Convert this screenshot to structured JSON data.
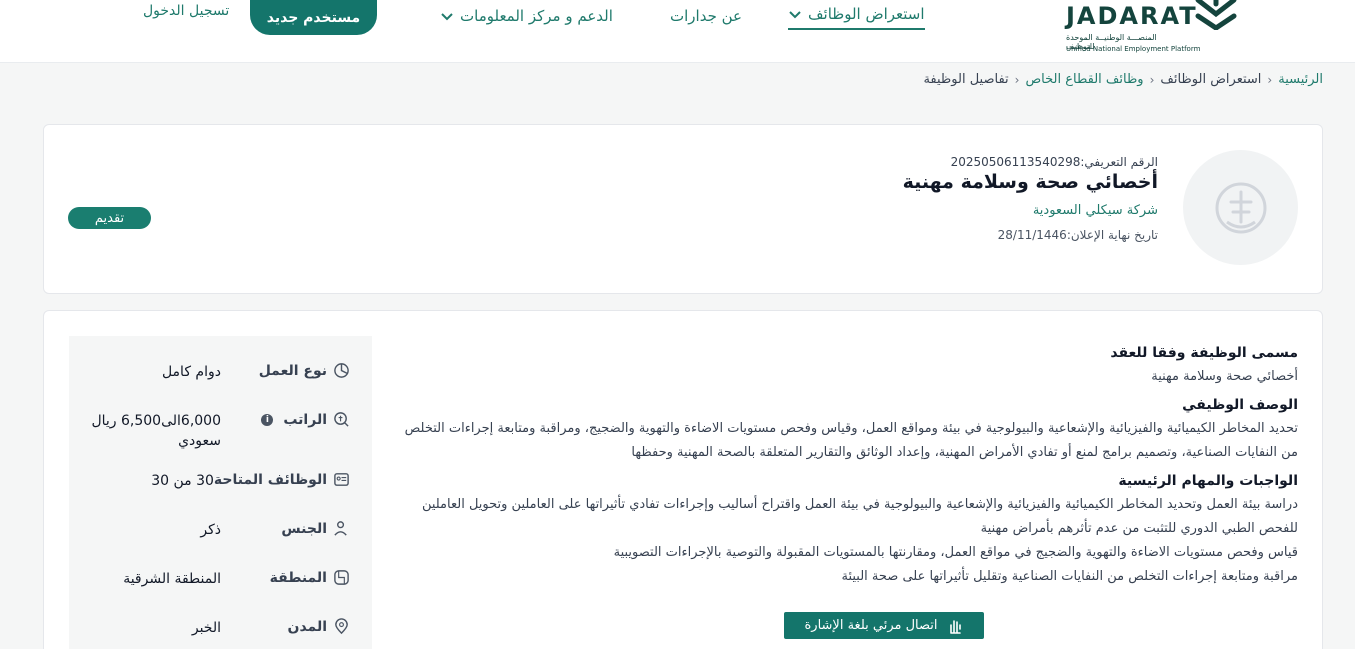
{
  "header": {
    "logo_word": "JADARAT",
    "logo_ar": "المنصـــة الوطنيــة الموحدة للتوظيف",
    "logo_en": "Unified National Employment Platform",
    "nav": {
      "browse_jobs": "استعراض الوظائف",
      "about": "عن جدارات",
      "support": "الدعم و مركز المعلومات"
    },
    "new_user_button": "مستخدم جديد",
    "login_link": "تسجيل الدخول"
  },
  "breadcrumb": {
    "home": "الرئيسية",
    "browse_jobs": "استعراض الوظائف",
    "private_sector": "وظائف القطاع الخاص",
    "current": "تفاصيل الوظيفة"
  },
  "job": {
    "id_line": "الرقم التعريفي:20250506113540298",
    "title": "أخصائي صحة وسلامة مهنية",
    "company": "شركة سيكلي السعودية",
    "deadline": "تاريخ نهاية الإعلان:28/11/1446",
    "apply_button": "تقديم"
  },
  "details": {
    "contract_title_heading": "مسمى الوظيفة وفقا للعقد",
    "contract_title": "أخصائي صحة وسلامة مهنية",
    "description_heading": "الوصف الوظيفي",
    "description": "تحديد المخاطر الكيميائية والفيزيائية والإشعاعية والبيولوجية في بيئة ومواقع العمل، وقياس وفحص مستويات الاضاءة والتهوية والضجيج، ومراقبة ومتابعة إجراءات التخلص من النفايات الصناعية، وتصميم برامج لمنع أو تفادي الأمراض المهنية، وإعداد الوثائق والتقارير المتعلقة بالصحة المهنية وحفظها",
    "duties_heading": "الواجبات والمهام الرئيسية",
    "duties_1": "دراسة بيئة العمل وتحديد المخاطر الكيميائية والفيزيائية والإشعاعية والبيولوجية في بيئة العمل واقتراح أساليب وإجراءات تفادي تأثيراتها على العاملين وتحويل العاملين للفحص الطبي الدوري للتثبت من عدم تأثرهم بأمراض مهنية",
    "duties_2": "قياس وفحص مستويات الاضاءة والتهوية والضجيج في مواقع العمل، ومقارنتها بالمستويات المقبولة والتوصية بالإجراءات التصويبية",
    "duties_3": "مراقبة ومتابعة إجراءات التخلص من النفايات الصناعية وتقليل تأثيراتها على صحة البيئة"
  },
  "side": {
    "work_type_label": "نوع العمل",
    "work_type": "دوام كامل",
    "salary_label": "الراتب",
    "salary": "6,000الى6,500 ريال سعودي",
    "vacancies_label": "الوظائف المتاحة",
    "vacancies": "30 من 30",
    "gender_label": "الجنس",
    "gender": "ذكر",
    "region_label": "المنطقة",
    "region": "المنطقة الشرقية",
    "city_label": "المدن",
    "city": "الخبر"
  },
  "sign_language": "اتصال مرئي بلغة الإشارة",
  "colors": {
    "brand": "#14756b",
    "link": "#1f7a6c",
    "background": "#f5f6f6"
  }
}
